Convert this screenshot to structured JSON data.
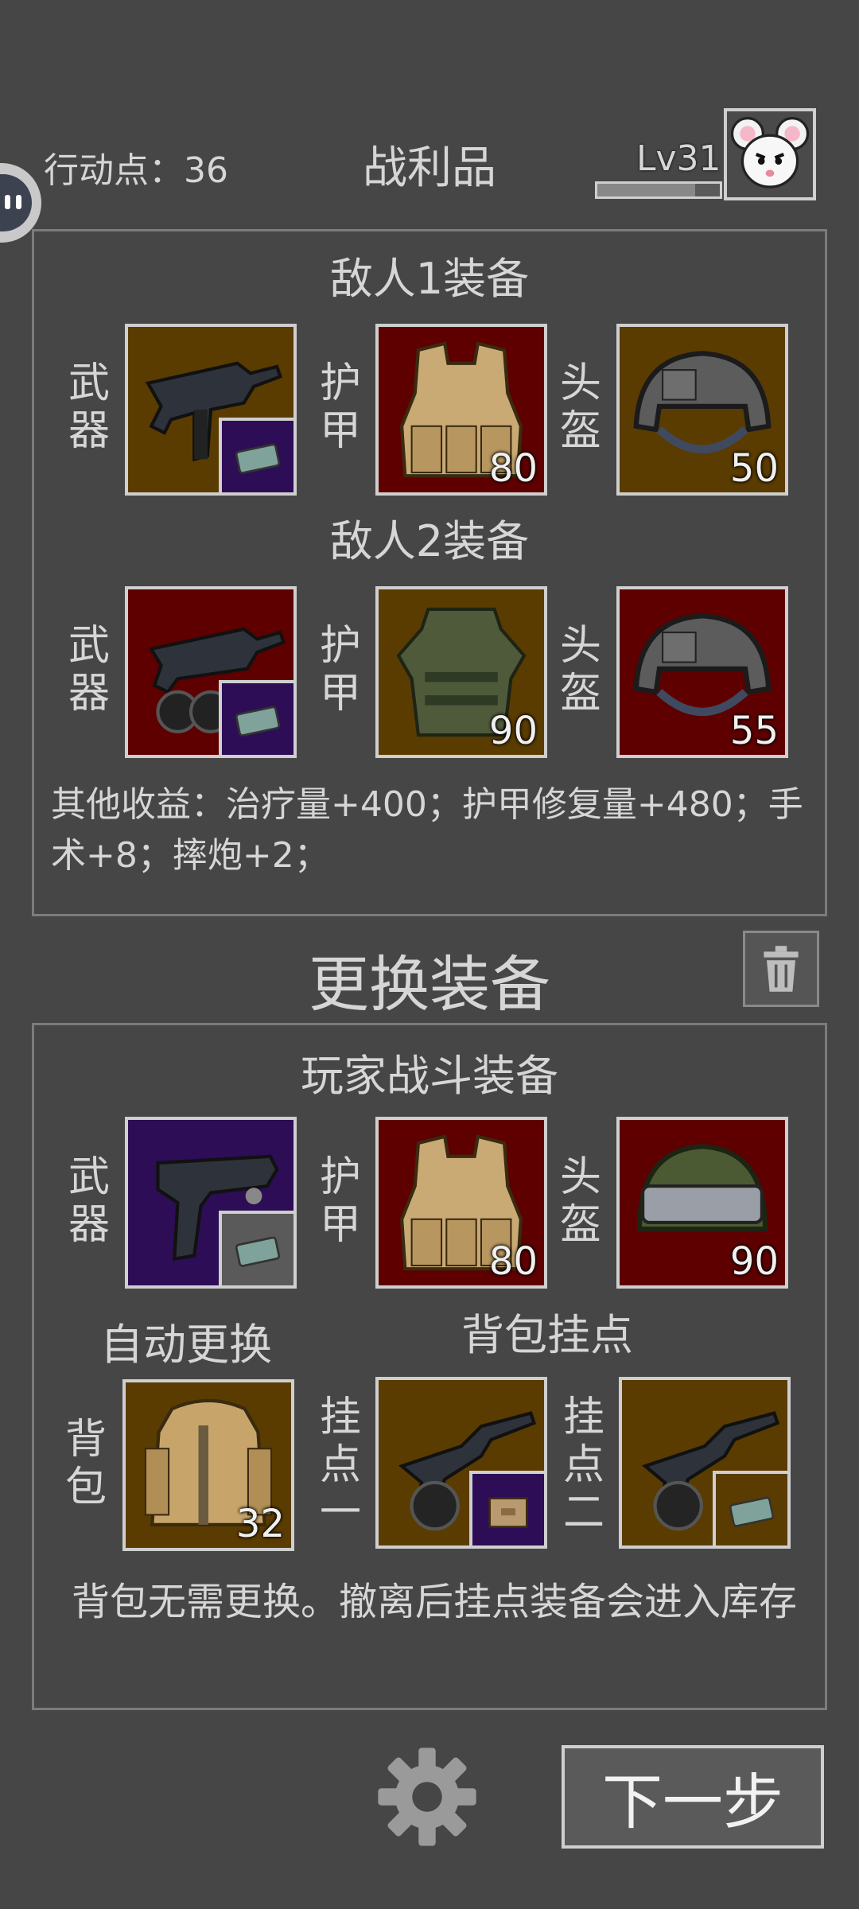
{
  "header": {
    "action_points": "行动点：36",
    "title": "战利品",
    "level": "Lv31",
    "level_progress": 0.8
  },
  "loot": {
    "enemy1_title": "敌人1装备",
    "enemy2_title": "敌人2装备",
    "labels": {
      "weapon": "武器",
      "armor": "护甲",
      "helmet": "头盔"
    },
    "enemy1": {
      "armor_value": "80",
      "helmet_value": "50"
    },
    "enemy2": {
      "armor_value": "90",
      "helmet_value": "55"
    },
    "other_gains": "其他收益：治疗量+400；护甲修复量+480；手术+8；摔炮+2；"
  },
  "swap": {
    "title": "更换装备",
    "player_title": "玩家战斗装备",
    "player": {
      "armor_value": "80",
      "helmet_value": "90"
    },
    "auto_swap": "自动更换",
    "backpack_mounts": "背包挂点",
    "backpack_label": "背包",
    "mount1_label": "挂点一",
    "mount2_label": "挂点二",
    "backpack_value": "32",
    "note": "背包无需更换。撤离后挂点装备会进入库存"
  },
  "footer": {
    "next_label": "下一步"
  }
}
